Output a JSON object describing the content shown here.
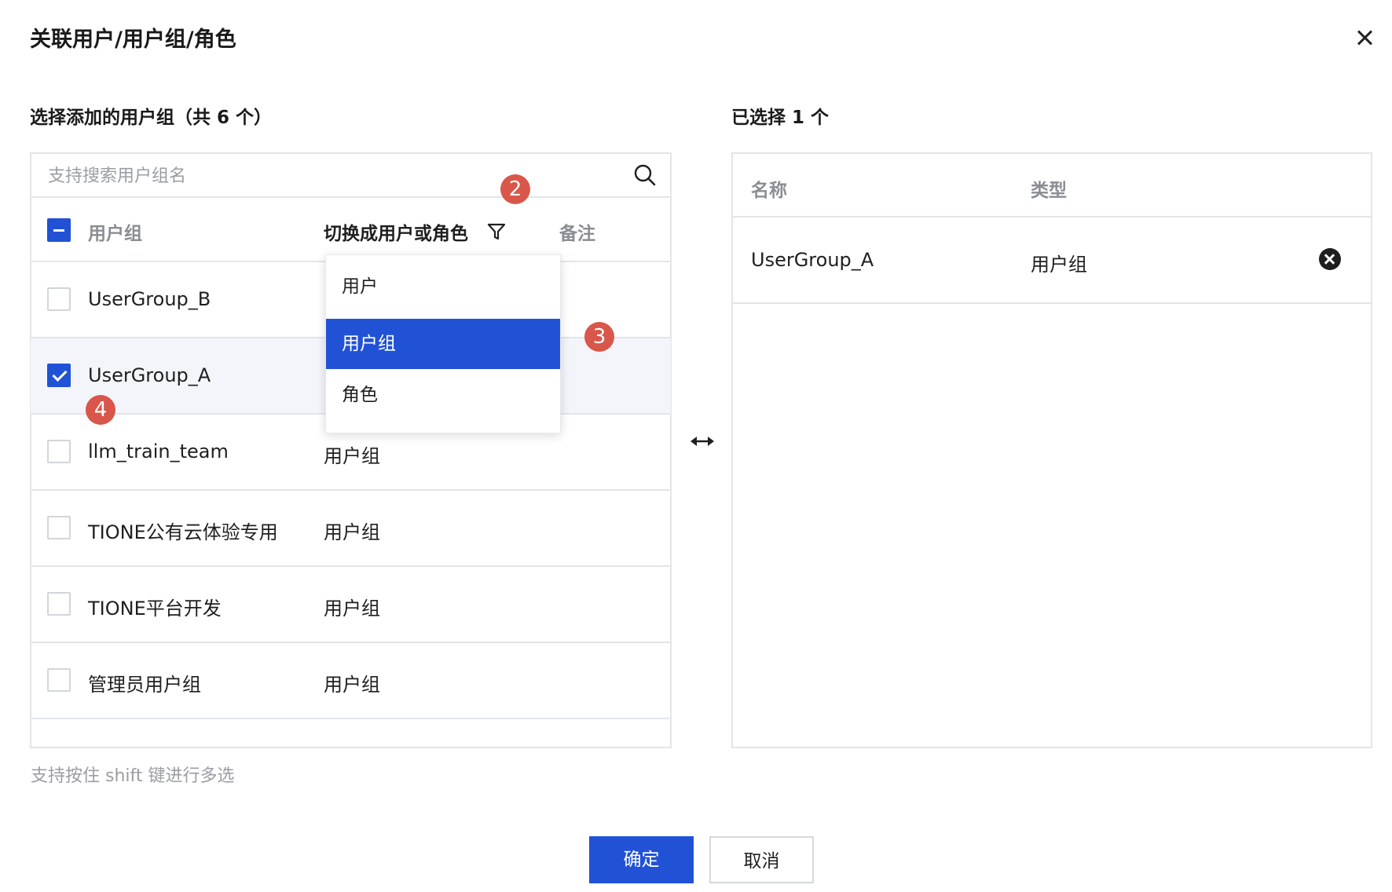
{
  "dialog": {
    "title": "关联用户/用户组/角色"
  },
  "left": {
    "title": "选择添加的用户组（共 6 个）",
    "search_placeholder": "支持搜索用户组名",
    "columns": {
      "name": "用户组",
      "switch": "切换成用户或角色",
      "remark": "备注"
    },
    "rows": [
      {
        "name": "UserGroup_B",
        "type": "",
        "checked": false
      },
      {
        "name": "UserGroup_A",
        "type": "",
        "checked": true
      },
      {
        "name": "llm_train_team",
        "type": "用户组",
        "checked": false
      },
      {
        "name": "TIONE公有云体验专用",
        "type": "用户组",
        "checked": false
      },
      {
        "name": "TIONE平台开发",
        "type": "用户组",
        "checked": false
      },
      {
        "name": "管理员用户组",
        "type": "用户组",
        "checked": false
      }
    ],
    "hint": "支持按住 shift 键进行多选"
  },
  "dropdown": {
    "options": [
      "用户",
      "用户组",
      "角色"
    ],
    "selected": "用户组"
  },
  "badges": {
    "b2": "2",
    "b3": "3",
    "b4": "4"
  },
  "right": {
    "title": "已选择 1 个",
    "columns": {
      "name": "名称",
      "type": "类型"
    },
    "rows": [
      {
        "name": "UserGroup_A",
        "type": "用户组"
      }
    ]
  },
  "footer": {
    "confirm": "确定",
    "cancel": "取消"
  },
  "colors": {
    "primary": "#2152d6",
    "badge": "#d9564a"
  }
}
